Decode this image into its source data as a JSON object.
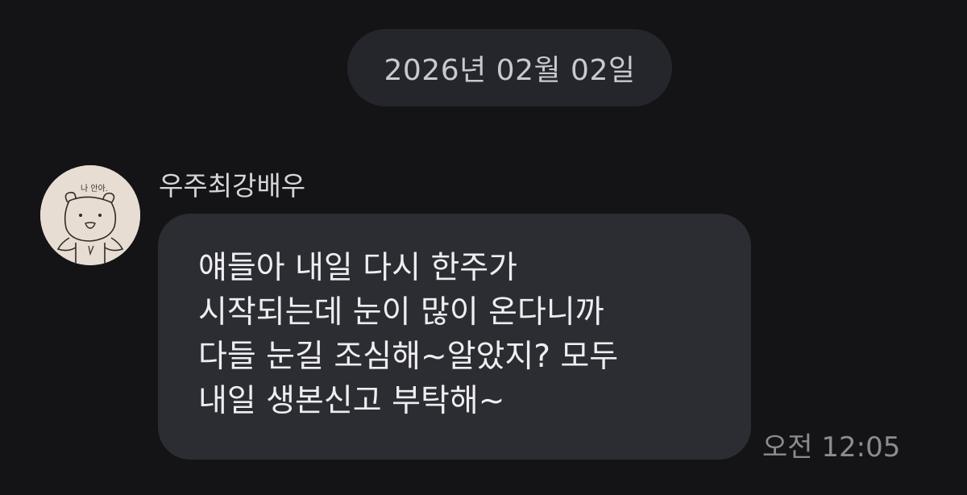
{
  "chat": {
    "date_separator": "2026년 02월 02일",
    "messages": [
      {
        "sender": "우주최강배우",
        "avatar_caption": "나 안아.",
        "lines": [
          "얘들아 내일 다시 한주가",
          "시작되는데 눈이 많이 온다니까",
          "다들 눈길 조심해~알았지?  모두",
          "내일 생본신고 부탁해~"
        ],
        "time": "오전 12:05"
      }
    ]
  },
  "colors": {
    "background": "#141417",
    "bubble": "#2c2d33",
    "date_pill": "#25262b",
    "timestamp": "#8b8c92"
  }
}
